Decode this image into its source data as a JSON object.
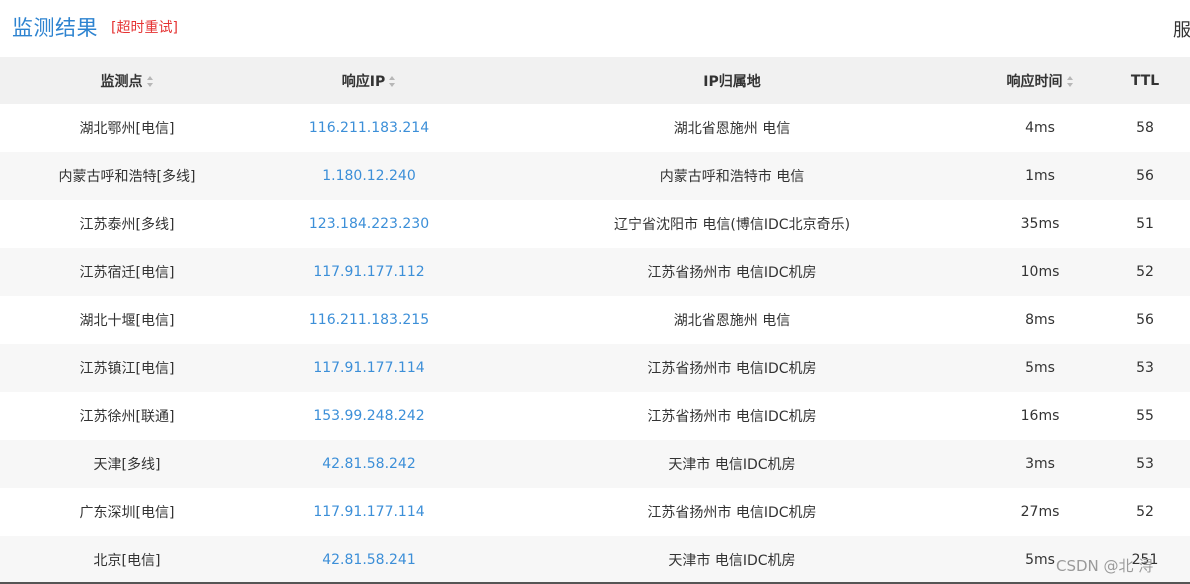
{
  "header": {
    "title": "监测结果",
    "retry_label": "[超时重试]",
    "cut_off_text": "服"
  },
  "table": {
    "columns": [
      {
        "label": "监测点",
        "sortable": true
      },
      {
        "label": "响应IP",
        "sortable": true
      },
      {
        "label": "IP归属地",
        "sortable": false
      },
      {
        "label": "响应时间",
        "sortable": true
      },
      {
        "label": "TTL",
        "sortable": false
      }
    ],
    "rows": [
      {
        "point": "湖北鄂州[电信]",
        "ip": "116.211.183.214",
        "location": "湖北省恩施州 电信",
        "time": "4ms",
        "ttl": "58"
      },
      {
        "point": "内蒙古呼和浩特[多线]",
        "ip": "1.180.12.240",
        "location": "内蒙古呼和浩特市 电信",
        "time": "1ms",
        "ttl": "56"
      },
      {
        "point": "江苏泰州[多线]",
        "ip": "123.184.223.230",
        "location": "辽宁省沈阳市 电信(博信IDC北京奇乐)",
        "time": "35ms",
        "ttl": "51"
      },
      {
        "point": "江苏宿迁[电信]",
        "ip": "117.91.177.112",
        "location": "江苏省扬州市 电信IDC机房",
        "time": "10ms",
        "ttl": "52"
      },
      {
        "point": "湖北十堰[电信]",
        "ip": "116.211.183.215",
        "location": "湖北省恩施州 电信",
        "time": "8ms",
        "ttl": "56"
      },
      {
        "point": "江苏镇江[电信]",
        "ip": "117.91.177.114",
        "location": "江苏省扬州市 电信IDC机房",
        "time": "5ms",
        "ttl": "53"
      },
      {
        "point": "江苏徐州[联通]",
        "ip": "153.99.248.242",
        "location": "江苏省扬州市 电信IDC机房",
        "time": "16ms",
        "ttl": "55"
      },
      {
        "point": "天津[多线]",
        "ip": "42.81.58.242",
        "location": "天津市 电信IDC机房",
        "time": "3ms",
        "ttl": "53"
      },
      {
        "point": "广东深圳[电信]",
        "ip": "117.91.177.114",
        "location": "江苏省扬州市 电信IDC机房",
        "time": "27ms",
        "ttl": "52"
      },
      {
        "point": "北京[电信]",
        "ip": "42.81.58.241",
        "location": "天津市 电信IDC机房",
        "time": "5ms",
        "ttl": "251"
      }
    ]
  },
  "watermark": "CSDN @北  浔",
  "colors": {
    "title": "#2d83d0",
    "retry": "#e53333",
    "ip_link": "#3c8fd8",
    "header_bg": "#f1f1f1",
    "stripe_bg": "#f7f7f7"
  }
}
